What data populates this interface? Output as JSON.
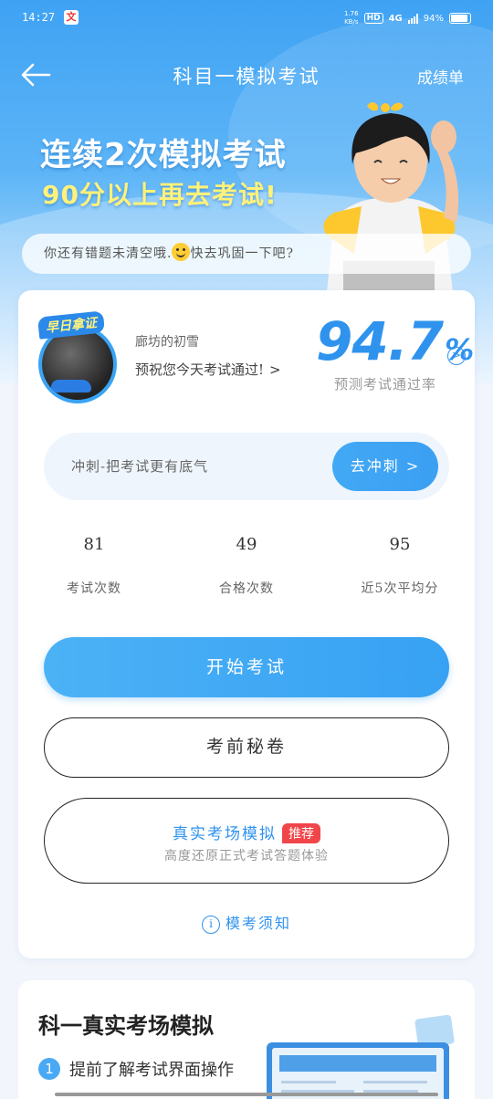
{
  "status_bar": {
    "time": "14:27",
    "app_icon_char": "文",
    "net_speed_top": "1.76",
    "net_speed_bottom": "KB/s",
    "hd": "HD",
    "network": "4G",
    "battery": "94%"
  },
  "nav": {
    "title": "科目一模拟考试",
    "right_link": "成绩单"
  },
  "promo": {
    "line1": "连续2次模拟考试",
    "line2": "90分以上再去考试!"
  },
  "tip": {
    "text_before": "你还有错题未清空哦.",
    "text_after": "快去巩固一下吧?"
  },
  "profile": {
    "badge": "早日拿证",
    "name": "廊坊的初雪",
    "wish": "预祝您今天考试通过!",
    "wish_chevron": ">"
  },
  "pass_rate": {
    "value": "94.7",
    "unit": "%",
    "label": "预测考试通过率",
    "arrow": ">"
  },
  "sprint": {
    "text": "冲刺-把考试更有底气",
    "button": "去冲刺 >"
  },
  "stats": [
    {
      "value": "81",
      "label": "考试次数"
    },
    {
      "value": "49",
      "label": "合格次数"
    },
    {
      "value": "95",
      "label": "近5次平均分"
    }
  ],
  "buttons": {
    "start": "开始考试",
    "secret": "考前秘卷",
    "real_title": "真实考场模拟",
    "real_tag": "推荐",
    "real_sub": "高度还原正式考试答题体验",
    "notice": "模考须知",
    "notice_icon": "i"
  },
  "section2": {
    "title": "科一真实考场模拟",
    "item_num": "1",
    "item_text": "提前了解考试界面操作"
  },
  "colors": {
    "accent": "#2f93ee",
    "tag_red": "#f0464a",
    "promo_yellow": "#fff27a"
  }
}
